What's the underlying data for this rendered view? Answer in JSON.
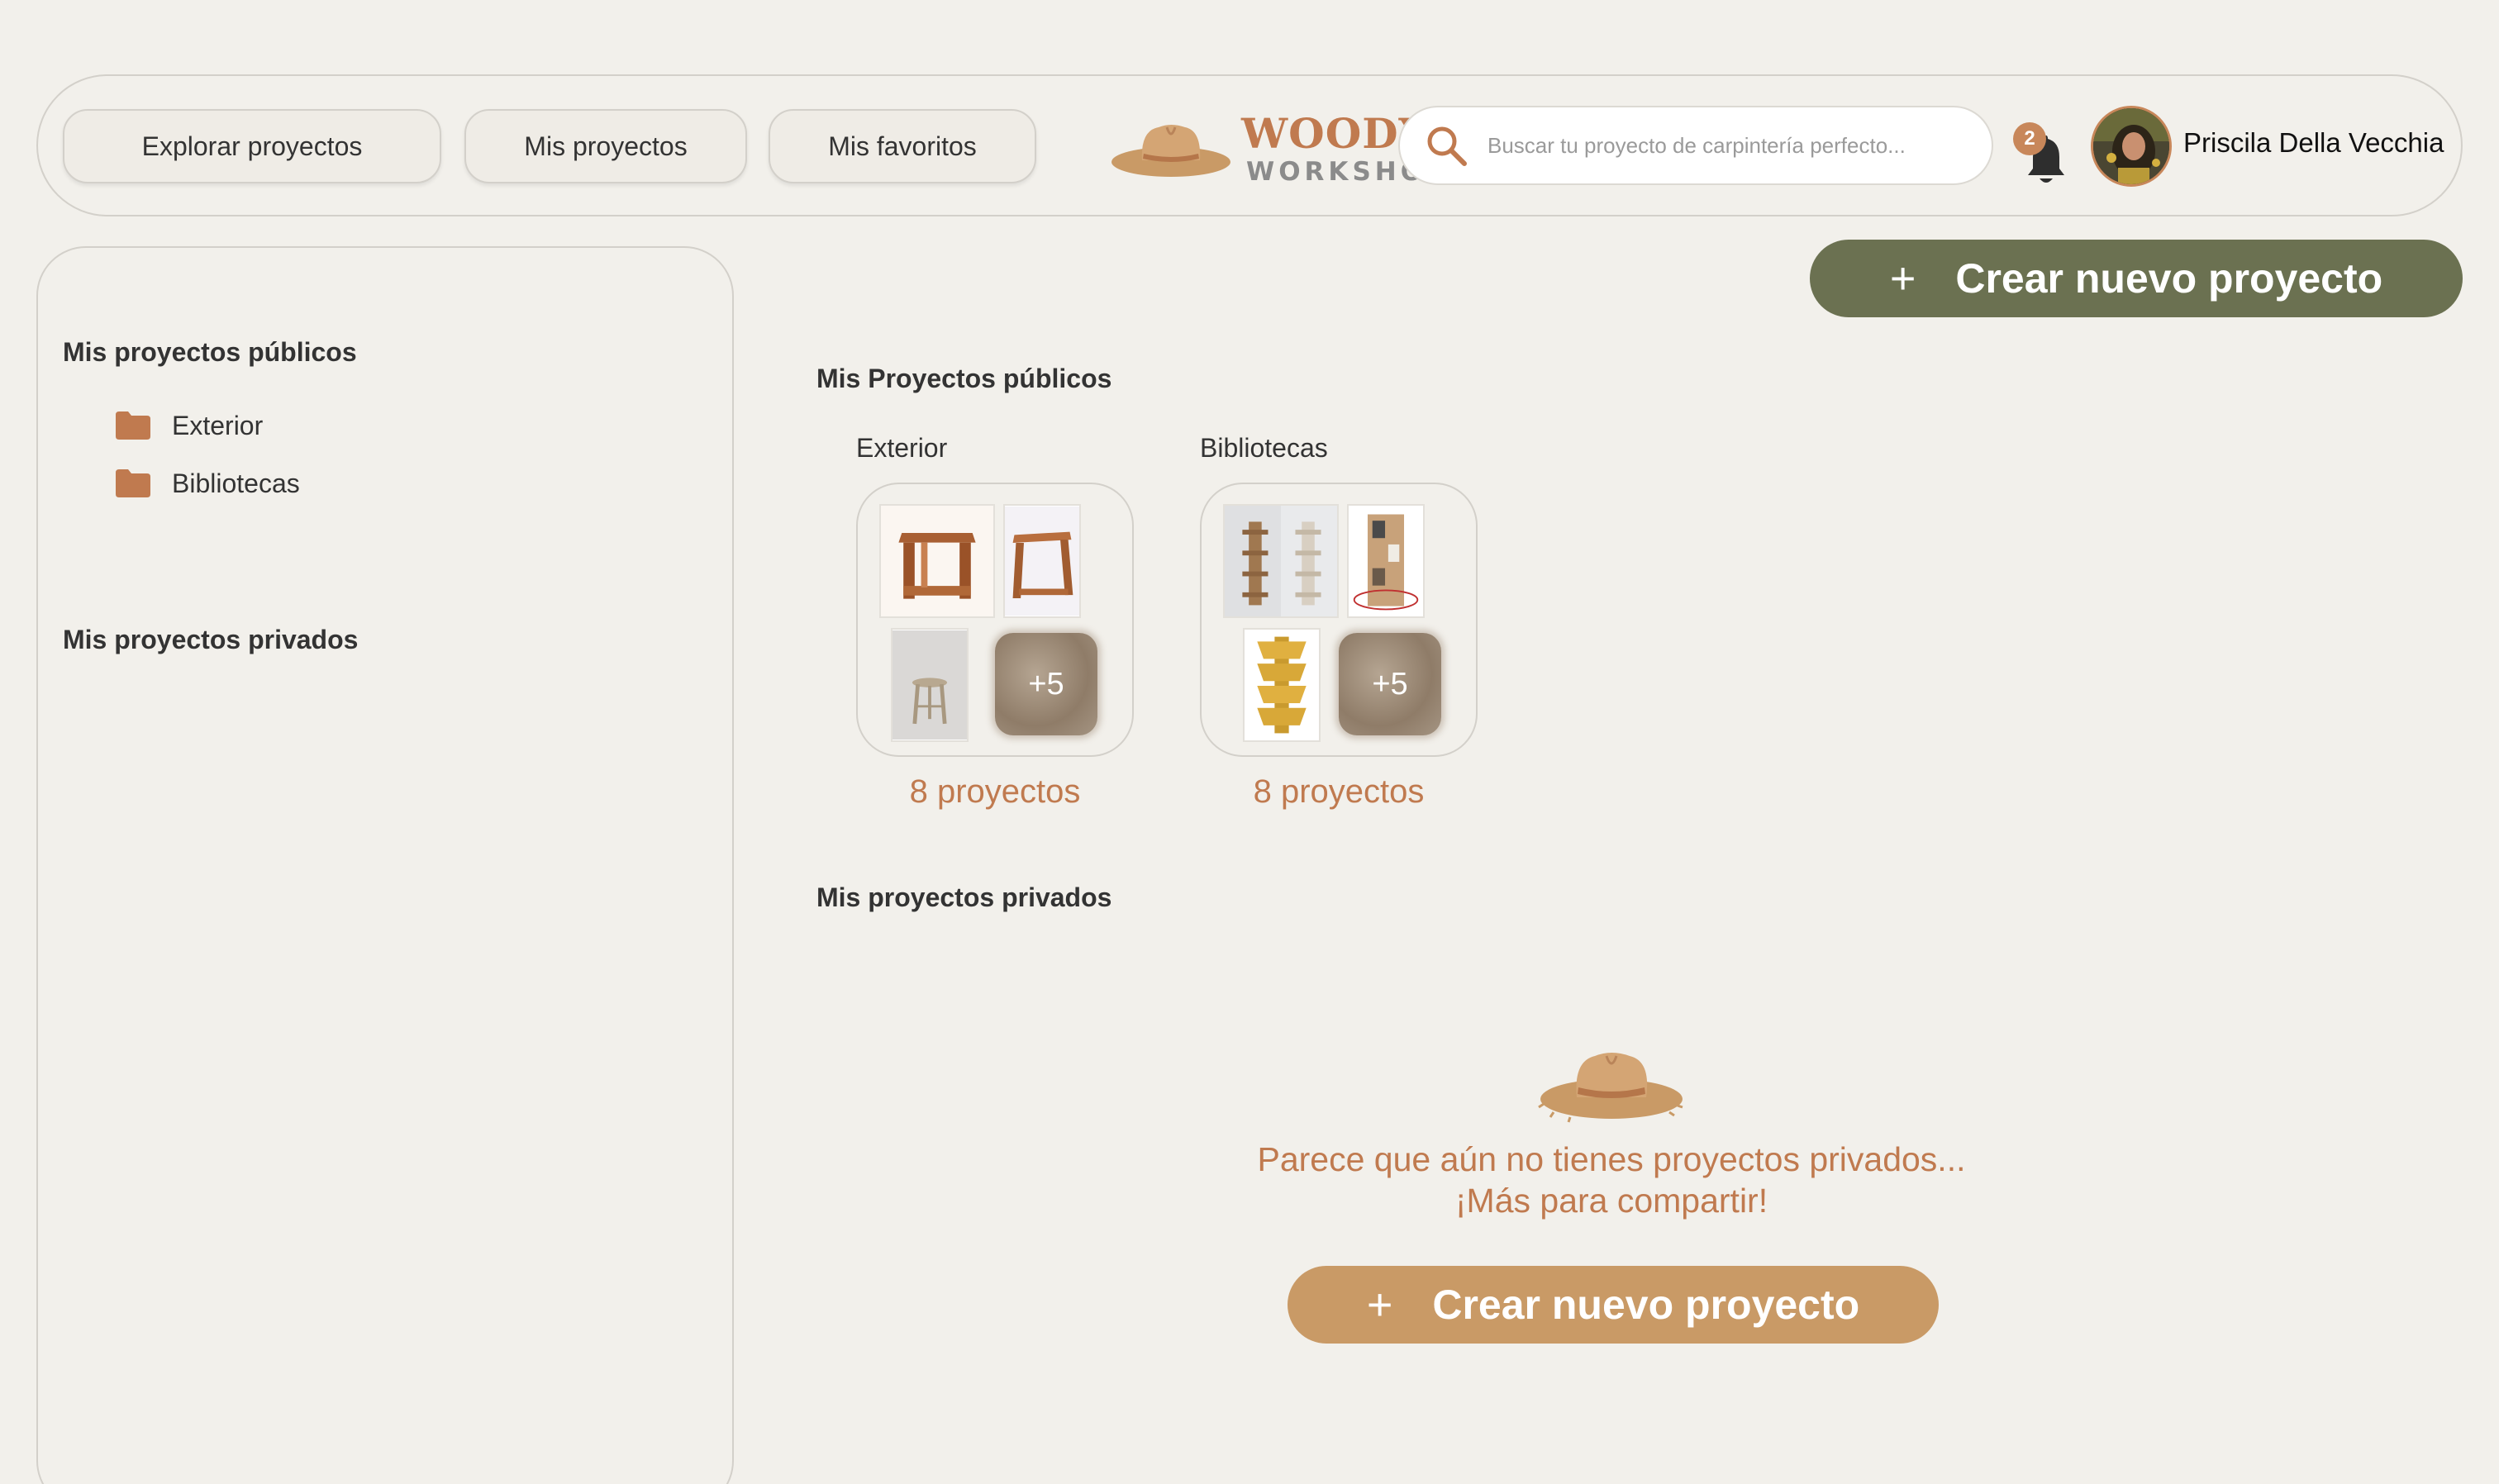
{
  "header": {
    "nav": [
      {
        "label": "Explorar proyectos"
      },
      {
        "label": "Mis proyectos"
      },
      {
        "label": "Mis favoritos"
      }
    ],
    "logo": {
      "line1": "WOODY'S",
      "line2": "WORKSHOP"
    },
    "search": {
      "placeholder": "Buscar tu proyecto de carpintería perfecto..."
    },
    "notifications": {
      "count": "2"
    },
    "user": {
      "name": "Priscila Della Vecchia"
    }
  },
  "sidebar": {
    "public_heading": "Mis proyectos públicos",
    "folders": [
      {
        "label": "Exterior"
      },
      {
        "label": "Bibliotecas"
      }
    ],
    "private_heading": "Mis proyectos privados"
  },
  "main": {
    "create_button": {
      "icon": "+",
      "label": "Crear nuevo proyecto"
    },
    "public_heading": "Mis Proyectos públicos",
    "collections": [
      {
        "title": "Exterior",
        "more": "+5",
        "count": "8 proyectos"
      },
      {
        "title": "Bibliotecas",
        "more": "+5",
        "count": "8 proyectos"
      }
    ],
    "private_heading": "Mis proyectos privados",
    "empty_state": {
      "line1": "Parece que aún no tienes proyectos privados...",
      "line2": "¡Más para compartir!",
      "button_icon": "+",
      "button_label": "Crear nuevo proyecto"
    }
  },
  "colors": {
    "background": "#f2f0eb",
    "accent": "#c07a4f",
    "olive": "#6b7151",
    "tan": "#c99a66"
  },
  "icons": [
    "hat-logo-icon",
    "search-icon",
    "bell-icon",
    "folder-icon",
    "plus-icon",
    "hat-illustration-icon"
  ]
}
